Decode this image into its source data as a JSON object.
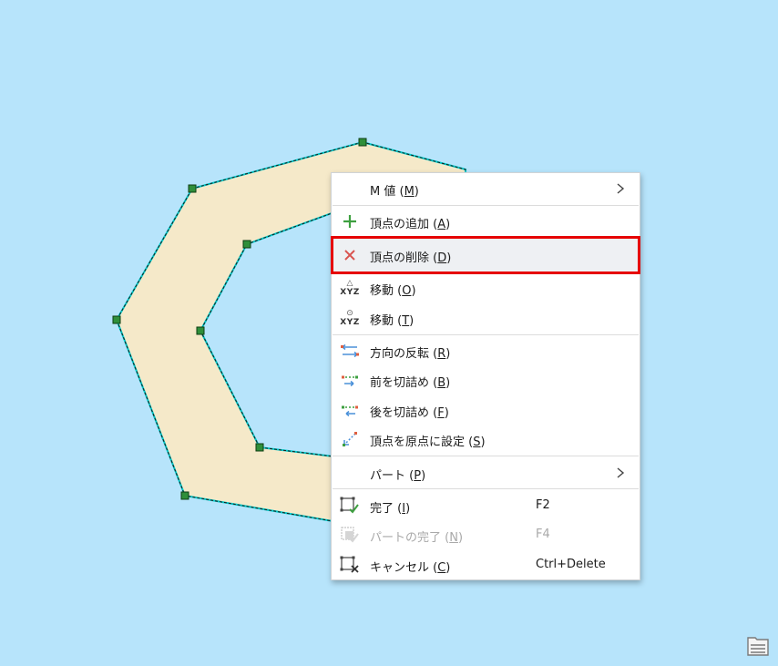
{
  "colors": {
    "map_background": "#b7e4fb",
    "polygon_fill": "#f5e9c9",
    "outline": "#00c8c8",
    "vertex": "#2f8f3a",
    "highlight_border": "#e60000",
    "add_icon": "#3ea040",
    "delete_icon": "#d9534f"
  },
  "menu": {
    "items": [
      {
        "key": "m_value",
        "label": "M 値 (",
        "mnemonic": "M",
        "suffix": ")",
        "submenu": true
      },
      {
        "key": "add_vertex",
        "label": "頂点の追加 (",
        "mnemonic": "A",
        "suffix": ")",
        "icon": "plus-icon"
      },
      {
        "key": "delete_vertex",
        "label": "頂点の削除 (",
        "mnemonic": "D",
        "suffix": ")",
        "icon": "x-delete-icon",
        "highlighted": true
      },
      {
        "key": "move_o",
        "label": "移動 (",
        "mnemonic": "O",
        "suffix": ")",
        "icon": "xyz-move-icon"
      },
      {
        "key": "move_t",
        "label": "移動 (",
        "mnemonic": "T",
        "suffix": ")",
        "icon": "xyz-target-icon"
      },
      {
        "key": "reverse",
        "label": "方向の反転 (",
        "mnemonic": "R",
        "suffix": ")",
        "icon": "reverse-direction-icon"
      },
      {
        "key": "trim_before",
        "label": "前を切詰め (",
        "mnemonic": "B",
        "suffix": ")",
        "icon": "trim-before-icon"
      },
      {
        "key": "trim_after",
        "label": "後を切詰め (",
        "mnemonic": "F",
        "suffix": ")",
        "icon": "trim-after-icon"
      },
      {
        "key": "set_origin",
        "label": "頂点を原点に設定 (",
        "mnemonic": "S",
        "suffix": ")",
        "icon": "set-origin-icon"
      },
      {
        "key": "part",
        "label": "パート (",
        "mnemonic": "P",
        "suffix": ")",
        "submenu": true
      },
      {
        "key": "finish",
        "label": "完了 (",
        "mnemonic": "I",
        "suffix": ")",
        "shortcut": "F2",
        "icon": "finish-icon"
      },
      {
        "key": "finish_part",
        "label": "パートの完了 (",
        "mnemonic": "N",
        "suffix": ")",
        "shortcut": "F4",
        "icon": "finish-part-icon",
        "disabled": true
      },
      {
        "key": "cancel",
        "label": "キャンセル (",
        "mnemonic": "C",
        "suffix": ")",
        "shortcut": "Ctrl+Delete",
        "icon": "cancel-icon"
      }
    ]
  }
}
